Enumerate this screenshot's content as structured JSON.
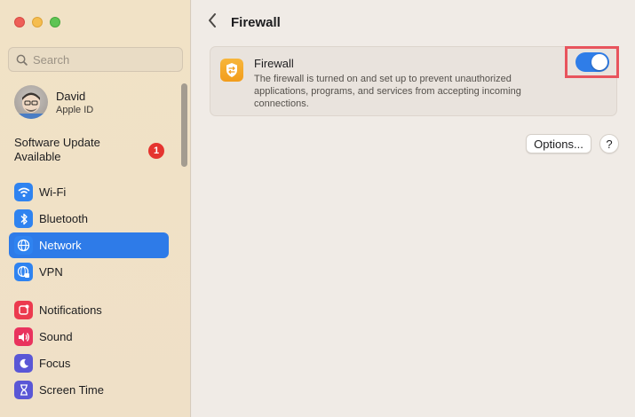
{
  "window": {
    "traffic_lights": [
      "close",
      "minimize",
      "zoom"
    ]
  },
  "sidebar": {
    "search_placeholder": "Search",
    "account": {
      "name": "David",
      "subtitle": "Apple ID"
    },
    "software_update": {
      "label": "Software Update Available",
      "badge": "1"
    },
    "groups": [
      [
        {
          "label": "Wi-Fi",
          "icon": "wifi-icon",
          "selected": false
        },
        {
          "label": "Bluetooth",
          "icon": "bluetooth-icon",
          "selected": false
        },
        {
          "label": "Network",
          "icon": "globe-icon",
          "selected": true
        },
        {
          "label": "VPN",
          "icon": "vpn-icon",
          "selected": false
        }
      ],
      [
        {
          "label": "Notifications",
          "icon": "bell-icon",
          "selected": false
        },
        {
          "label": "Sound",
          "icon": "speaker-icon",
          "selected": false
        },
        {
          "label": "Focus",
          "icon": "moon-icon",
          "selected": false
        },
        {
          "label": "Screen Time",
          "icon": "hourglass-icon",
          "selected": false
        }
      ]
    ]
  },
  "main": {
    "title": "Firewall",
    "firewall": {
      "title": "Firewall",
      "description": "The firewall is turned on and set up to prevent unauthorized applications, programs, and services from accepting incoming connections.",
      "enabled": true
    },
    "options_label": "Options...",
    "help_label": "?"
  },
  "colors": {
    "accent": "#2e7be8",
    "badge": "#e5342f",
    "highlight_box": "#e8545d",
    "firewall_icon": "#f29d1c"
  }
}
